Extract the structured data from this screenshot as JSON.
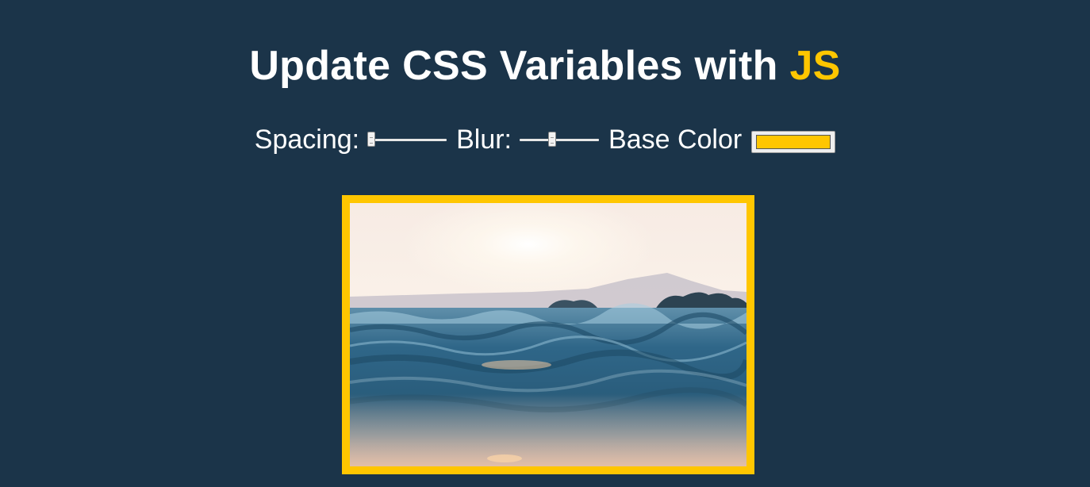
{
  "page": {
    "title_main": "Update CSS Variables with ",
    "title_highlight": "JS"
  },
  "controls": {
    "spacing": {
      "label": "Spacing:",
      "value": 10,
      "min": 10,
      "max": 200
    },
    "blur": {
      "label": "Blur:",
      "value": 10,
      "min": 0,
      "max": 25
    },
    "base_color": {
      "label": "Base Color",
      "value": "#ffc600"
    }
  },
  "colors": {
    "background": "#1b3449",
    "accent": "#ffc600",
    "text": "#ffffff"
  },
  "image": {
    "subject": "ocean waves at sunset"
  }
}
